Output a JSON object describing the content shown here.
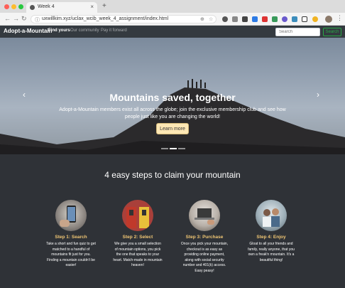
{
  "browser": {
    "tab_title": "Week 4",
    "tab_close": "×",
    "new_tab": "+",
    "url": "uxwillkim.xyz/uclax_wcib_week_4_assignment/index.html",
    "back": "←",
    "forward": "→",
    "reload": "↻",
    "menu": "⋮"
  },
  "site": {
    "brand": "Adopt-a-Mountain",
    "nav": [
      {
        "label": "Find yours"
      },
      {
        "label": "Our community"
      },
      {
        "label": "Pay it forward"
      }
    ],
    "search_placeholder": "Search",
    "search_button": "Search"
  },
  "hero": {
    "title": "Mountains saved, together",
    "text": "Adopt-a-Mountain members exist all across the globe; join the exclusive membership club and see how people just like you are changing the world!",
    "button": "Learn more",
    "prev": "‹",
    "next": "›",
    "slides": 3,
    "active_slide": 1
  },
  "steps": {
    "heading": "4 easy steps to claim your mountain",
    "items": [
      {
        "title": "Step 1: Search",
        "text": "Take a short and fun quiz to get matched to a handful of mountains fit just for you. Finding a mountain couldn't be easier!",
        "icon": "phone-photo"
      },
      {
        "title": "Step 2: Select",
        "text": "We give you a small selection of mountain options, you pick the one that speaks to your heart. Match-made in mountain heaven!",
        "icon": "doors-photo"
      },
      {
        "title": "Step 3: Purchase",
        "text": "Once you pick your mountain, checkout is as easy as providing online payment, along with social security number and 401(k) access. Easy peasy!",
        "icon": "laptop-photo"
      },
      {
        "title": "Step 4: Enjoy",
        "text": "Gloat to all your friends and family, really anyone, that you own a freak'n mountain. It's a beautiful thing!",
        "icon": "friends-photo"
      }
    ]
  }
}
